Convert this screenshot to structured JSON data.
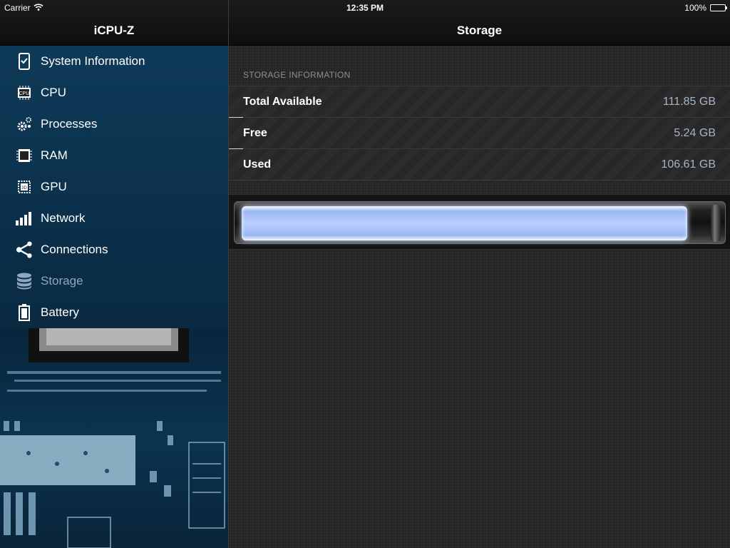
{
  "status_bar": {
    "carrier": "Carrier",
    "time": "12:35 PM",
    "battery": "100%"
  },
  "sidebar": {
    "title": "iCPU-Z",
    "items": [
      {
        "label": "System Information",
        "icon": "phone-check-icon"
      },
      {
        "label": "CPU",
        "icon": "cpu-icon"
      },
      {
        "label": "Processes",
        "icon": "gears-icon"
      },
      {
        "label": "RAM",
        "icon": "ram-icon"
      },
      {
        "label": "GPU",
        "icon": "gpu-icon"
      },
      {
        "label": "Network",
        "icon": "signal-bars-icon"
      },
      {
        "label": "Connections",
        "icon": "share-icon"
      },
      {
        "label": "Storage",
        "icon": "database-icon",
        "active": true
      },
      {
        "label": "Battery",
        "icon": "battery-icon"
      }
    ]
  },
  "main": {
    "title": "Storage",
    "section_title": "STORAGE INFORMATION",
    "rows": [
      {
        "label": "Total Available",
        "value": "111.85 GB"
      },
      {
        "label": "Free",
        "value": "5.24 GB"
      },
      {
        "label": "Used",
        "value": "106.61 GB"
      }
    ],
    "usage_fraction": 0.953
  },
  "colors": {
    "active_item": "#8ea8c4",
    "value_text": "#a6b4c6",
    "menu_bg": "#0e3a58"
  }
}
